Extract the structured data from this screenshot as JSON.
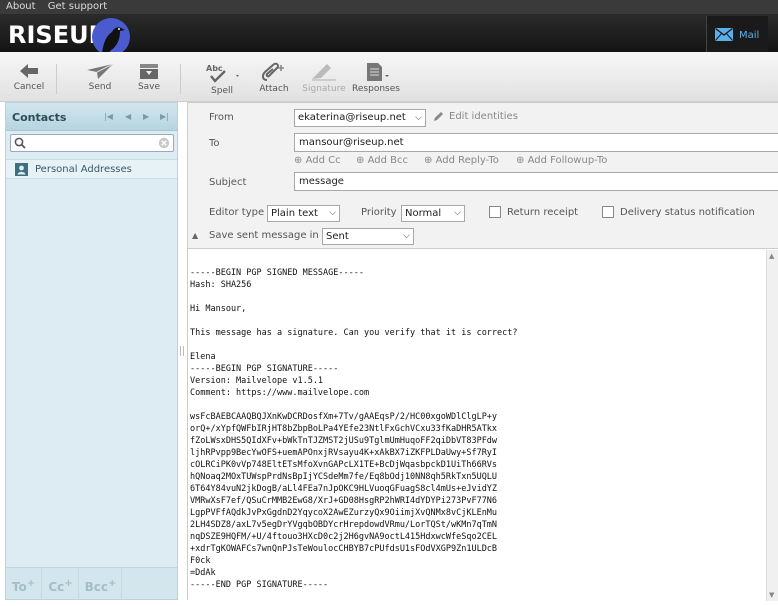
{
  "topnav": {
    "about": "About",
    "support": "Get support"
  },
  "brand": {
    "logo_text": "RISEUP"
  },
  "mail_tab": {
    "label": "Mail"
  },
  "toolbar": {
    "cancel": "Cancel",
    "send": "Send",
    "save": "Save",
    "spell": "Spell",
    "attach": "Attach",
    "signature": "Signature",
    "responses": "Responses"
  },
  "contacts": {
    "title": "Contacts",
    "search_placeholder": "",
    "book_label": "Personal Addresses",
    "footer": {
      "to": "To",
      "cc": "Cc",
      "bcc": "Bcc",
      "plus": "+"
    }
  },
  "compose": {
    "from_label": "From",
    "from_value": "ekaterina@riseup.net",
    "edit_identities": "Edit identities",
    "to_label": "To",
    "to_value": "mansour@riseup.net",
    "add_cc": "Add Cc",
    "add_bcc": "Add Bcc",
    "add_reply_to": "Add Reply-To",
    "add_followup_to": "Add Followup-To",
    "subject_label": "Subject",
    "subject_value": "message",
    "editor_type_label": "Editor type",
    "editor_type_value": "Plain text",
    "priority_label": "Priority",
    "priority_value": "Normal",
    "return_receipt": "Return receipt",
    "delivery_status": "Delivery status notification",
    "save_sent_label": "Save sent message in",
    "save_sent_value": "Sent"
  },
  "message_body": "-----BEGIN PGP SIGNED MESSAGE-----\nHash: SHA256\n\nHi Mansour,\n\nThis message has a signature. Can you verify that it is correct?\n\nElena\n-----BEGIN PGP SIGNATURE-----\nVersion: Mailvelope v1.5.1\nComment: https://www.mailvelope.com\n\nwsFcBAEBCAAQBQJXnKwDCRDosfXm+7Tv/gAAEqsP/2/HC00xgoWDlClgLP+y\norQ+/xYpfQWFbIRjHT8bZbpBoLPa4YEfe23NtlFxGchVCxu33fKaDHR5ATkx\nfZoLWsxDHS5QIdXFv+bWkTnTJZMST2jUSu9TglmUmHuqoFF2qiDbVT83PFdw\nljhRPvpp9BecYwOFS+uemAPOnxjRVsayu4K+xAkBX7iZKFPLDaUwy+Sf7RyI\ncOLRCiPK0vVp748EltETsMfoXvnGAPcLX1TE+BcDjWqasbpckD1UiTh66RVs\nhQNoaq2MOxTUWspPrdNsBpIjYCSdeMm7fe/Eq8bOdj10NN8qh5RkTxn5UQLU\n6T64Y84vuN2jkDogB/aLl4FEa7nJpOKC9HLVuoqGFuagS8cl4mUs+eJvidYZ\nVMRwXsF7ef/QSuCrMMB2EwG8/XrJ+GD08HsgRP2hWRI4dYDYPi273PvF77N6\nLgpPVFfAQdkJvPxGgdnD2YqycoX2AwEZurzyQx9OiimjXvQNMx8vCjKLEnMu\n2LH4SDZ8/axL7v5egDrYVgqbOBDYcrHrepdowdVRmu/LorTQSt/wKMn7qTmN\nnqDSZE9HQFM/+U/4ftouo3HXcD0c2j2H6gvNA9octL415HdxwcWfeSqo2CEL\n+xdrTgKOWAFCs7wnQnPJsTeWoulocCHBYB7cPUfdsU1sFOdVXGP9Zn1ULDcB\nF0ck\n=DdAk\n-----END PGP SIGNATURE-----",
  "colors": {
    "accent": "#5ab0e8",
    "contacts_bg": "#dcecf2",
    "header_bg": "#1e1e1e",
    "logo_circle": "#4a5bd0"
  },
  "icons": [
    "mail-icon",
    "cancel-arrow-icon",
    "send-plane-icon",
    "save-tray-icon",
    "spell-check-icon",
    "paperclip-icon",
    "signature-pen-icon",
    "document-icon",
    "search-icon",
    "clear-icon",
    "address-book-icon",
    "pencil-icon",
    "plus-circle-icon",
    "collapse-arrow-icon"
  ]
}
